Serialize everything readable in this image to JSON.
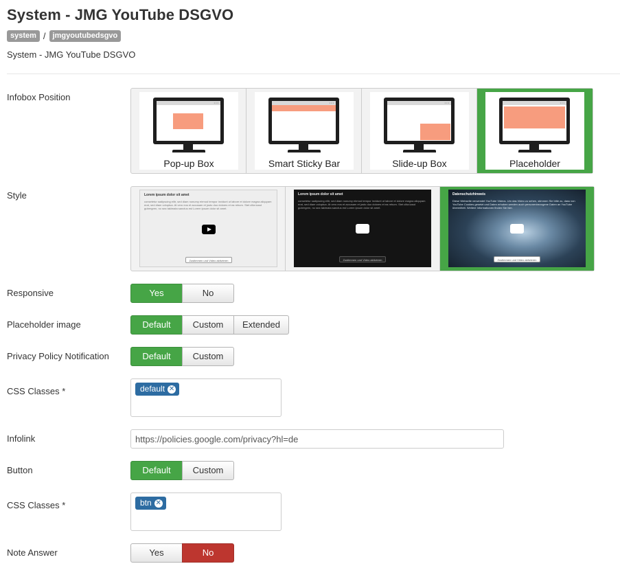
{
  "header": {
    "title": "System - JMG YouTube DSGVO",
    "badges": [
      "system",
      "jmgyoutubedsgvo"
    ],
    "separator": "/",
    "description": "System - JMG YouTube DSGVO"
  },
  "fields": {
    "infobox_position": {
      "label": "Infobox Position",
      "options": [
        "Pop-up Box",
        "Smart Sticky Bar",
        "Slide-up Box",
        "Placeholder"
      ],
      "selected": "Placeholder"
    },
    "style": {
      "label": "Style",
      "options": [
        {
          "title": "Lorem ipsum dolor sit amet",
          "text": "consetetur sadipscing elitr, sed diam nonumy eirmod tempor invidunt ut labore et dolore magna aliquyam erat, sed diam voluptua. At vero eos et accusam et justo duo dolores et ea rebum. Stet clita kasd gubergren, no sea takimata sanctus est Lorem ipsum dolor sit amet.",
          "button": "Zustimmen und Video aktivieren"
        },
        {
          "title": "Lorem ipsum dolor sit amet",
          "text": "consetetur sadipscing elitr, sed diam nonumy eirmod tempor invidunt ut labore et dolore magna aliquyam erat, sed diam voluptua. At vero eos et accusam et justo duo dolores et ea rebum. Stet clita kasd gubergren, no sea takimata sanctus est Lorem ipsum dolor sit amet.",
          "button": "Zustimmen und Video aktivieren"
        },
        {
          "title": "Datenschutzhinweis",
          "text": "Diese Webseite verwendet YouTube Videos. Um das Video zu sehen, stimmen Sie bitte zu, dass von YouTube Cookies gesetzt und Daten erhoben werden auch personenbezogene Daten an YouTube übermittelt. Weitere Informationen finden Sie hier.",
          "button": "Zustimmen und Video aktivieren"
        }
      ],
      "selected_index": 2
    },
    "responsive": {
      "label": "Responsive",
      "options": [
        "Yes",
        "No"
      ],
      "selected": "Yes"
    },
    "placeholder_image": {
      "label": "Placeholder image",
      "options": [
        "Default",
        "Custom",
        "Extended"
      ],
      "selected": "Default"
    },
    "privacy_policy": {
      "label": "Privacy Policy Notification",
      "options": [
        "Default",
        "Custom"
      ],
      "selected": "Default"
    },
    "css_classes_1": {
      "label": "CSS Classes *",
      "tag": "default"
    },
    "infolink": {
      "label": "Infolink",
      "value": "https://policies.google.com/privacy?hl=de"
    },
    "button": {
      "label": "Button",
      "options": [
        "Default",
        "Custom"
      ],
      "selected": "Default"
    },
    "css_classes_2": {
      "label": "CSS Classes *",
      "tag": "btn"
    },
    "note_answer": {
      "label": "Note Answer",
      "options": [
        "Yes",
        "No"
      ],
      "selected": "No"
    }
  },
  "colors": {
    "active_green": "#46a546",
    "active_red": "#bd362f",
    "chip_blue": "#2d6ca2",
    "badge_gray": "#999999",
    "salmon": "#f79c7e"
  }
}
